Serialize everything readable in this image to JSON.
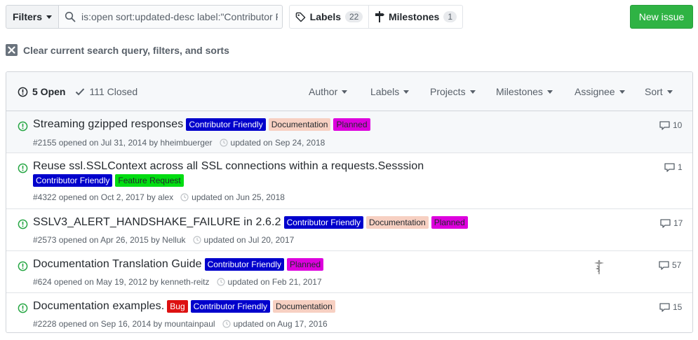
{
  "toolbar": {
    "filters_label": "Filters",
    "search_value": "is:open sort:updated-desc label:\"Contributor F",
    "labels_label": "Labels",
    "labels_count": "22",
    "milestones_label": "Milestones",
    "milestones_count": "1",
    "new_issue_label": "New issue"
  },
  "clear_query": {
    "label": "Clear current search query, filters, and sorts"
  },
  "header": {
    "open_label": "5 Open",
    "closed_label": "111 Closed",
    "filters": {
      "author": "Author",
      "labels": "Labels",
      "projects": "Projects",
      "milestones": "Milestones",
      "assignee": "Assignee",
      "sort": "Sort"
    }
  },
  "label_names": {
    "contributor": "Contributor Friendly",
    "documentation": "Documentation",
    "planned": "Planned",
    "feature": "Feature Request",
    "bug": "Bug"
  },
  "colors": {
    "contributor": "#0000cc",
    "documentation": "#f7d0c2",
    "planned": "#dd00dd",
    "feature": "#00dd11",
    "bug": "#dd1111",
    "open_icon": "#28a745",
    "new_issue": "#2fb344"
  },
  "issues": [
    {
      "title": "Streaming gzipped responses",
      "opened": "#2155 opened on Jul 31, 2014 by hheimbuerger",
      "updated": "updated on Sep 24, 2018",
      "comments": "10"
    },
    {
      "title": "Reuse ssl.SSLContext across all SSL connections within a requests.Sesssion",
      "opened": "#4322 opened on Oct 2, 2017 by alex",
      "updated": "updated on Jun 25, 2018",
      "comments": "1"
    },
    {
      "title": "SSLV3_ALERT_HANDSHAKE_FAILURE in 2.6.2",
      "opened": "#2573 opened on Apr 26, 2015 by Nelluk",
      "updated": "updated on Jul 20, 2017",
      "comments": "17"
    },
    {
      "title": "Documentation Translation Guide",
      "opened": "#624 opened on May 19, 2012 by kenneth-reitz",
      "updated": "updated on Feb 21, 2017",
      "comments": "57"
    },
    {
      "title": "Documentation examples.",
      "opened": "#2228 opened on Sep 16, 2014 by mountainpaul",
      "updated": "updated on Aug 17, 2016",
      "comments": "15"
    }
  ]
}
